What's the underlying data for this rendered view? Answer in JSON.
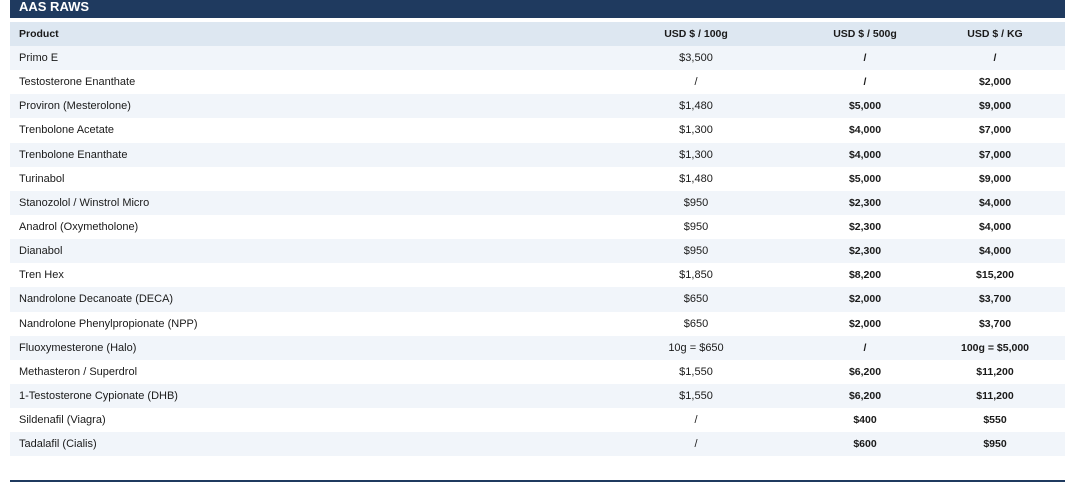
{
  "title": "AAS RAWS",
  "columns": [
    "Product",
    "USD $ / 100g",
    "USD $ / 500g",
    "USD $ / KG"
  ],
  "rows": [
    [
      "Primo E",
      "$3,500",
      "/",
      "/"
    ],
    [
      "Testosterone Enanthate",
      "/",
      "/",
      "$2,000"
    ],
    [
      "Proviron (Mesterolone)",
      "$1,480",
      "$5,000",
      "$9,000"
    ],
    [
      "Trenbolone Acetate",
      "$1,300",
      "$4,000",
      "$7,000"
    ],
    [
      "Trenbolone Enanthate",
      "$1,300",
      "$4,000",
      "$7,000"
    ],
    [
      "Turinabol",
      "$1,480",
      "$5,000",
      "$9,000"
    ],
    [
      "Stanozolol / Winstrol Micro",
      "$950",
      "$2,300",
      "$4,000"
    ],
    [
      "Anadrol (Oxymetholone)",
      "$950",
      "$2,300",
      "$4,000"
    ],
    [
      "Dianabol",
      "$950",
      "$2,300",
      "$4,000"
    ],
    [
      "Tren Hex",
      "$1,850",
      "$8,200",
      "$15,200"
    ],
    [
      "Nandrolone Decanoate (DECA)",
      "$650",
      "$2,000",
      "$3,700"
    ],
    [
      "Nandrolone Phenylpropionate (NPP)",
      "$650",
      "$2,000",
      "$3,700"
    ],
    [
      "Fluoxymesterone (Halo)",
      "10g = $650",
      "/",
      "100g = $5,000"
    ],
    [
      "Methasteron / Superdrol",
      "$1,550",
      "$6,200",
      "$11,200"
    ],
    [
      "1-Testosterone Cypionate (DHB)",
      "$1,550",
      "$6,200",
      "$11,200"
    ],
    [
      "Sildenafil (Viagra)",
      "/",
      "$400",
      "$550"
    ],
    [
      "Tadalafil (Cialis)",
      "/",
      "$600",
      "$950"
    ]
  ],
  "colors": {
    "header_bar": "#1f3a5f",
    "column_header": "#dde7f1",
    "stripe": "#f1f5fa"
  }
}
